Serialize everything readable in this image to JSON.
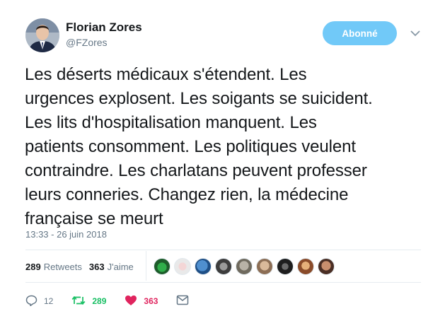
{
  "author": {
    "name": "Florian Zores",
    "handle": "@FZores"
  },
  "follow_button": {
    "label": "Abonné"
  },
  "tweet": {
    "lines": [
      "Les déserts médicaux s'étendent. Les",
      "urgences explosent. Les soigants se suicident.",
      "Les lits d'hospitalisation manquent. Les",
      "patients consomment. Les politiques veulent",
      "contraindre. Les charlatans peuvent professer",
      "leurs conneries. Changez rien, la médecine",
      "française se meurt"
    ],
    "timestamp": "13:33 - 26 juin 2018"
  },
  "stats": {
    "retweets_count": "289",
    "retweets_label": "Retweets",
    "likes_count": "363",
    "likes_label": "J'aime"
  },
  "actions": {
    "reply_count": "12",
    "retweet_count": "289",
    "like_count": "363"
  },
  "colors": {
    "follow_button": "#71c9f8",
    "retweet": "#17bf63",
    "like": "#e0245e",
    "muted": "#657786"
  },
  "icons": [
    "chevron-down-icon",
    "reply-icon",
    "retweet-icon",
    "heart-icon",
    "message-icon"
  ]
}
